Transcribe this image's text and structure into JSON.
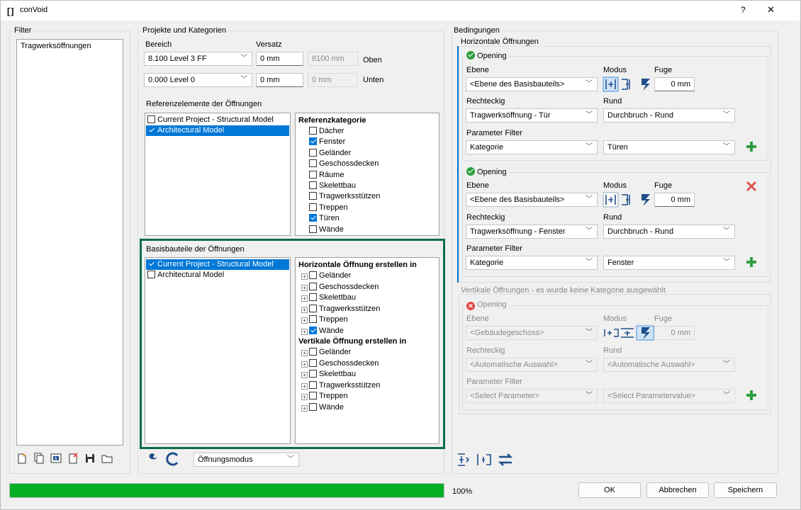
{
  "window": {
    "title": "conVoid",
    "help": "?",
    "close": "✕"
  },
  "filter": {
    "label": "Filter",
    "items": [
      "Tragwerksöffnungen"
    ]
  },
  "projects": {
    "label": "Projekte und Kategorien",
    "bereich_label": "Bereich",
    "versatz_label": "Versatz",
    "top": {
      "level": "8.100  Level 3 FF",
      "offset": "0 mm",
      "elev": "8100 mm",
      "side": "Oben"
    },
    "bottom": {
      "level": "0.000  Level 0",
      "offset": "0 mm",
      "elev": "0 mm",
      "side": "Unten"
    },
    "ref_label": "Referenzelemente der Öffnungen",
    "ref_models": [
      {
        "label": "Current Project - Structural Model",
        "checked": false,
        "selected": false
      },
      {
        "label": "Architectural Model",
        "checked": true,
        "selected": true
      }
    ],
    "ref_cat_header": "Referenzkategorie",
    "ref_categories": [
      {
        "label": "Dächer",
        "checked": false
      },
      {
        "label": "Fenster",
        "checked": true
      },
      {
        "label": "Geländer",
        "checked": false
      },
      {
        "label": "Geschossdecken",
        "checked": false
      },
      {
        "label": "Räume",
        "checked": false
      },
      {
        "label": "Skelettbau",
        "checked": false
      },
      {
        "label": "Tragwerksstützen",
        "checked": false
      },
      {
        "label": "Treppen",
        "checked": false
      },
      {
        "label": "Türen",
        "checked": true
      },
      {
        "label": "Wände",
        "checked": false
      }
    ],
    "base_label": "Basisbauteile der Öffnungen",
    "base_models": [
      {
        "label": "Current Project - Structural Model",
        "checked": true,
        "selected": true
      },
      {
        "label": "Architectural Model",
        "checked": false,
        "selected": false
      }
    ],
    "horiz_header": "Horizontale Öffnung erstellen in",
    "horiz_items": [
      {
        "label": "Geländer",
        "checked": false
      },
      {
        "label": "Geschossdecken",
        "checked": false
      },
      {
        "label": "Skelettbau",
        "checked": false
      },
      {
        "label": "Tragwerksstützen",
        "checked": false
      },
      {
        "label": "Treppen",
        "checked": false
      },
      {
        "label": "Wände",
        "checked": true
      }
    ],
    "vert_header": "Vertikale Öffnung erstellen in",
    "vert_items": [
      {
        "label": "Geländer",
        "checked": false
      },
      {
        "label": "Geschossdecken",
        "checked": false
      },
      {
        "label": "Skelettbau",
        "checked": false
      },
      {
        "label": "Tragwerksstützen",
        "checked": false
      },
      {
        "label": "Treppen",
        "checked": false
      },
      {
        "label": "Wände",
        "checked": false
      }
    ],
    "mode_combo": "Öffnungsmodus"
  },
  "conditions": {
    "label": "Bedingungen",
    "horiz_label": "Horizontale Öffnungen",
    "vert_label": "Vertikale Öffnungen - es wurde keine Kategorie ausgewählt",
    "labels": {
      "ebene": "Ebene",
      "modus": "Modus",
      "fuge": "Fuge",
      "rechteckig": "Rechteckig",
      "rund": "Rund",
      "param": "Parameter Filter"
    },
    "openings": [
      {
        "title": "Opening",
        "ebene": "<Ebene des Basisbauteils>",
        "fuge": "0 mm",
        "rect": "Tragwerksöffnung - Tür",
        "round": "Durchbruch - Rund",
        "param": "Kategorie",
        "value": "Türen"
      },
      {
        "title": "Opening",
        "ebene": "<Ebene des Basisbauteils>",
        "fuge": "0 mm",
        "rect": "Tragwerksöffnung - Fenster",
        "round": "Durchbruch - Rund",
        "param": "Kategorie",
        "value": "Fenster"
      }
    ],
    "vert_opening": {
      "title": "Opening",
      "ebene": "<Gebäudegeschoss>",
      "fuge": "0 mm",
      "rect": "<Automatische Auswahl>",
      "round": "<Automatische Auswahl>",
      "param": "<Select Parameter>",
      "value": "<Select Parametervalue>"
    }
  },
  "footer": {
    "progress_text": "100%",
    "progress": 1.0,
    "ok": "OK",
    "cancel": "Abbrechen",
    "save": "Speichern"
  },
  "colors": {
    "accent": "#0078d7",
    "progress": "#06b025",
    "highlight": "#0a6e48",
    "plus": "#2e9e3e",
    "delete": "#d9534f"
  }
}
